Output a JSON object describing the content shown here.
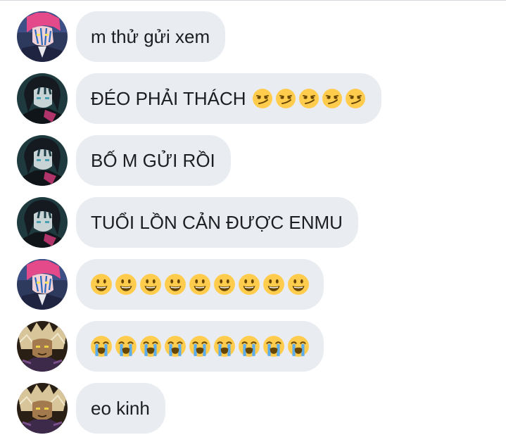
{
  "messages": [
    {
      "avatar": "akaza-avatar",
      "text": "m thử gửi xem",
      "emojis": []
    },
    {
      "avatar": "enmu-avatar",
      "text": "ĐÉO PHẢI THÁCH",
      "emojis": [
        "smirk",
        "smirk",
        "smirk",
        "smirk",
        "smirk"
      ]
    },
    {
      "avatar": "enmu-avatar",
      "text": "BỐ M GỬI RỒI",
      "emojis": []
    },
    {
      "avatar": "enmu-avatar",
      "text": "TUỔI LỒN CẢN ĐƯỢC ENMU",
      "emojis": []
    },
    {
      "avatar": "akaza-avatar",
      "text": "",
      "emojis": [
        "smiley",
        "smiley",
        "smiley",
        "smiley",
        "smiley",
        "smiley",
        "smiley",
        "smiley",
        "smiley"
      ]
    },
    {
      "avatar": "gyutaro-avatar",
      "text": "",
      "emojis": [
        "loudly-crying",
        "loudly-crying",
        "loudly-crying",
        "loudly-crying",
        "loudly-crying",
        "loudly-crying",
        "loudly-crying",
        "loudly-crying",
        "loudly-crying"
      ]
    },
    {
      "avatar": "gyutaro-avatar",
      "text": "eo kinh",
      "emojis": []
    }
  ],
  "colors": {
    "bubble": "#e9ecf0",
    "text": "#1c1e21",
    "emoji_face": "#ffcc4d"
  }
}
